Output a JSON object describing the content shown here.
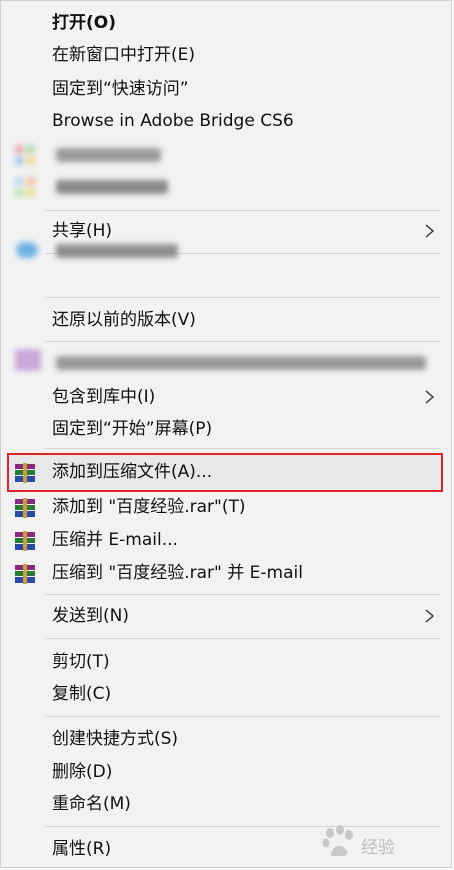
{
  "menu": {
    "open": "打开(O)",
    "open_new_window": "在新窗口中打开(E)",
    "pin_quick_access": "固定到“快速访问”",
    "browse_bridge": "Browse in Adobe Bridge CS6",
    "share": "共享(H)",
    "restore_versions": "还原以前的版本(V)",
    "include_library": "包含到库中(I)",
    "pin_start": "固定到“开始”屏幕(P)",
    "add_archive": "添加到压缩文件(A)...",
    "add_named_rar": "添加到 \"百度经验.rar\"(T)",
    "compress_email": "压缩并 E-mail...",
    "compress_named_email": "压缩到 \"百度经验.rar\" 并 E-mail",
    "send_to": "发送到(N)",
    "cut": "剪切(T)",
    "copy": "复制(C)",
    "create_shortcut": "创建快捷方式(S)",
    "delete": "删除(D)",
    "rename": "重命名(M)",
    "properties": "属性(R)"
  },
  "watermark": {
    "text": "经验"
  },
  "icons": {
    "winrar": "winrar-icon",
    "submenu": "chevron-right-icon"
  },
  "colors": {
    "highlight_border": "#e0222a",
    "menu_bg": "#f2f2f2"
  }
}
